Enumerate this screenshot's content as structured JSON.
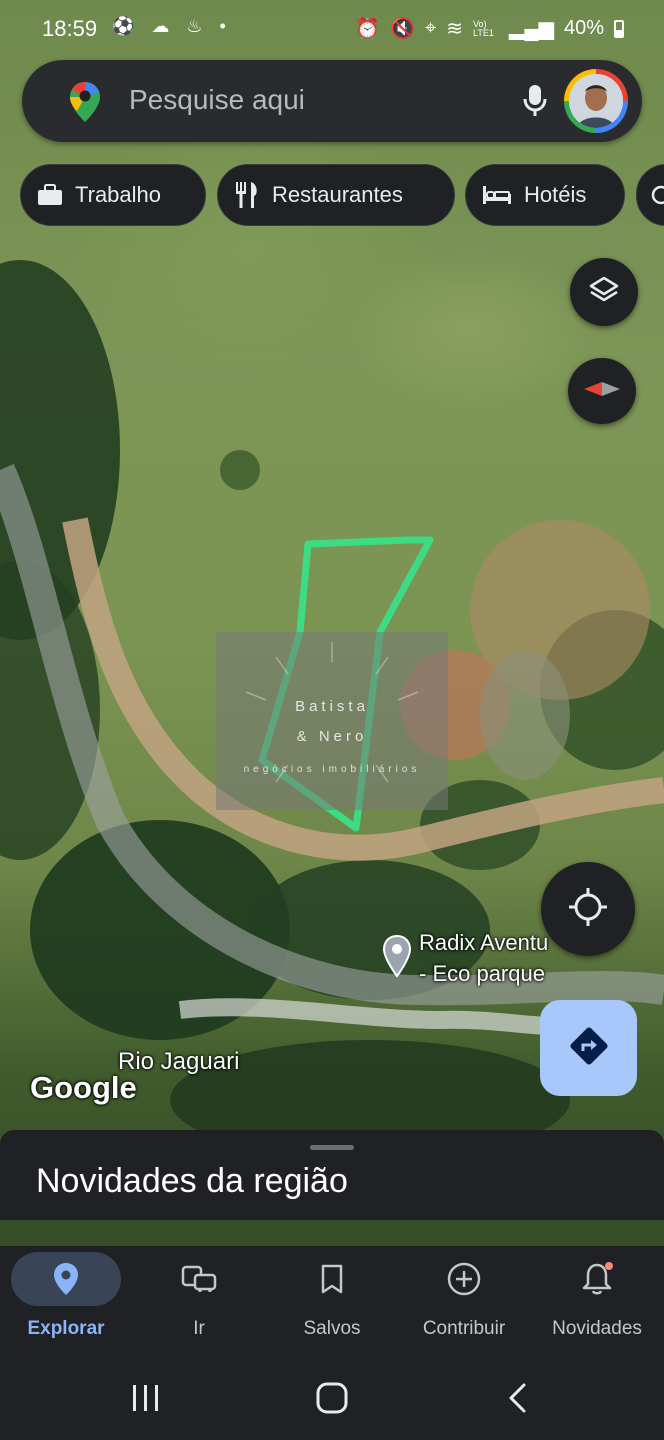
{
  "status_bar": {
    "time": "18:59",
    "battery": "40%",
    "network": "Vo) LTE1"
  },
  "search": {
    "placeholder": "Pesquise aqui"
  },
  "chips": [
    {
      "label": "Trabalho",
      "icon": "briefcase-icon"
    },
    {
      "label": "Restaurantes",
      "icon": "fork-knife-icon"
    },
    {
      "label": "Hotéis",
      "icon": "bed-icon"
    }
  ],
  "map": {
    "watermark_line1": "Batista",
    "watermark_line2": "& Nero",
    "watermark_line3": "negócios imobiliários",
    "place_name_line1": "Radix Aventu",
    "place_name_line2": "- Eco parque",
    "river_label": "Rio Jaguari",
    "attribution": "Google",
    "boundary_color": "#3ddc84"
  },
  "sheet": {
    "title": "Novidades da região"
  },
  "nav": [
    {
      "label": "Explorar",
      "icon": "explore-pin-icon",
      "active": true
    },
    {
      "label": "Ir",
      "icon": "commute-icon"
    },
    {
      "label": "Salvos",
      "icon": "bookmark-icon"
    },
    {
      "label": "Contribuir",
      "icon": "add-circle-icon"
    },
    {
      "label": "Novidades",
      "icon": "bell-icon"
    }
  ],
  "colors": {
    "accent": "#8ab4f8",
    "active_pill": "#394457",
    "directions_button": "#a8c7fa"
  }
}
